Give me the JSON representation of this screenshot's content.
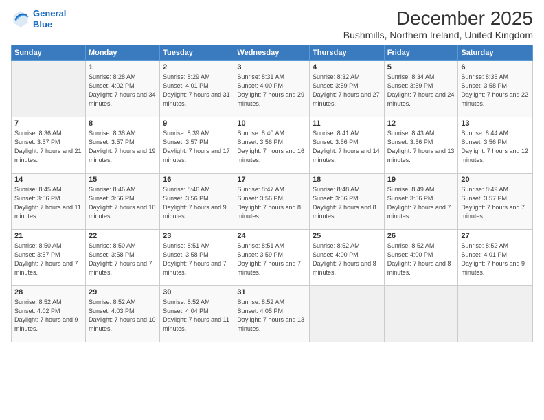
{
  "logo": {
    "line1": "General",
    "line2": "Blue"
  },
  "title": "December 2025",
  "subtitle": "Bushmills, Northern Ireland, United Kingdom",
  "header_days": [
    "Sunday",
    "Monday",
    "Tuesday",
    "Wednesday",
    "Thursday",
    "Friday",
    "Saturday"
  ],
  "weeks": [
    [
      {
        "day": "",
        "sunrise": "",
        "sunset": "",
        "daylight": ""
      },
      {
        "day": "1",
        "sunrise": "Sunrise: 8:28 AM",
        "sunset": "Sunset: 4:02 PM",
        "daylight": "Daylight: 7 hours and 34 minutes."
      },
      {
        "day": "2",
        "sunrise": "Sunrise: 8:29 AM",
        "sunset": "Sunset: 4:01 PM",
        "daylight": "Daylight: 7 hours and 31 minutes."
      },
      {
        "day": "3",
        "sunrise": "Sunrise: 8:31 AM",
        "sunset": "Sunset: 4:00 PM",
        "daylight": "Daylight: 7 hours and 29 minutes."
      },
      {
        "day": "4",
        "sunrise": "Sunrise: 8:32 AM",
        "sunset": "Sunset: 3:59 PM",
        "daylight": "Daylight: 7 hours and 27 minutes."
      },
      {
        "day": "5",
        "sunrise": "Sunrise: 8:34 AM",
        "sunset": "Sunset: 3:59 PM",
        "daylight": "Daylight: 7 hours and 24 minutes."
      },
      {
        "day": "6",
        "sunrise": "Sunrise: 8:35 AM",
        "sunset": "Sunset: 3:58 PM",
        "daylight": "Daylight: 7 hours and 22 minutes."
      }
    ],
    [
      {
        "day": "7",
        "sunrise": "Sunrise: 8:36 AM",
        "sunset": "Sunset: 3:57 PM",
        "daylight": "Daylight: 7 hours and 21 minutes."
      },
      {
        "day": "8",
        "sunrise": "Sunrise: 8:38 AM",
        "sunset": "Sunset: 3:57 PM",
        "daylight": "Daylight: 7 hours and 19 minutes."
      },
      {
        "day": "9",
        "sunrise": "Sunrise: 8:39 AM",
        "sunset": "Sunset: 3:57 PM",
        "daylight": "Daylight: 7 hours and 17 minutes."
      },
      {
        "day": "10",
        "sunrise": "Sunrise: 8:40 AM",
        "sunset": "Sunset: 3:56 PM",
        "daylight": "Daylight: 7 hours and 16 minutes."
      },
      {
        "day": "11",
        "sunrise": "Sunrise: 8:41 AM",
        "sunset": "Sunset: 3:56 PM",
        "daylight": "Daylight: 7 hours and 14 minutes."
      },
      {
        "day": "12",
        "sunrise": "Sunrise: 8:43 AM",
        "sunset": "Sunset: 3:56 PM",
        "daylight": "Daylight: 7 hours and 13 minutes."
      },
      {
        "day": "13",
        "sunrise": "Sunrise: 8:44 AM",
        "sunset": "Sunset: 3:56 PM",
        "daylight": "Daylight: 7 hours and 12 minutes."
      }
    ],
    [
      {
        "day": "14",
        "sunrise": "Sunrise: 8:45 AM",
        "sunset": "Sunset: 3:56 PM",
        "daylight": "Daylight: 7 hours and 11 minutes."
      },
      {
        "day": "15",
        "sunrise": "Sunrise: 8:46 AM",
        "sunset": "Sunset: 3:56 PM",
        "daylight": "Daylight: 7 hours and 10 minutes."
      },
      {
        "day": "16",
        "sunrise": "Sunrise: 8:46 AM",
        "sunset": "Sunset: 3:56 PM",
        "daylight": "Daylight: 7 hours and 9 minutes."
      },
      {
        "day": "17",
        "sunrise": "Sunrise: 8:47 AM",
        "sunset": "Sunset: 3:56 PM",
        "daylight": "Daylight: 7 hours and 8 minutes."
      },
      {
        "day": "18",
        "sunrise": "Sunrise: 8:48 AM",
        "sunset": "Sunset: 3:56 PM",
        "daylight": "Daylight: 7 hours and 8 minutes."
      },
      {
        "day": "19",
        "sunrise": "Sunrise: 8:49 AM",
        "sunset": "Sunset: 3:56 PM",
        "daylight": "Daylight: 7 hours and 7 minutes."
      },
      {
        "day": "20",
        "sunrise": "Sunrise: 8:49 AM",
        "sunset": "Sunset: 3:57 PM",
        "daylight": "Daylight: 7 hours and 7 minutes."
      }
    ],
    [
      {
        "day": "21",
        "sunrise": "Sunrise: 8:50 AM",
        "sunset": "Sunset: 3:57 PM",
        "daylight": "Daylight: 7 hours and 7 minutes."
      },
      {
        "day": "22",
        "sunrise": "Sunrise: 8:50 AM",
        "sunset": "Sunset: 3:58 PM",
        "daylight": "Daylight: 7 hours and 7 minutes."
      },
      {
        "day": "23",
        "sunrise": "Sunrise: 8:51 AM",
        "sunset": "Sunset: 3:58 PM",
        "daylight": "Daylight: 7 hours and 7 minutes."
      },
      {
        "day": "24",
        "sunrise": "Sunrise: 8:51 AM",
        "sunset": "Sunset: 3:59 PM",
        "daylight": "Daylight: 7 hours and 7 minutes."
      },
      {
        "day": "25",
        "sunrise": "Sunrise: 8:52 AM",
        "sunset": "Sunset: 4:00 PM",
        "daylight": "Daylight: 7 hours and 8 minutes."
      },
      {
        "day": "26",
        "sunrise": "Sunrise: 8:52 AM",
        "sunset": "Sunset: 4:00 PM",
        "daylight": "Daylight: 7 hours and 8 minutes."
      },
      {
        "day": "27",
        "sunrise": "Sunrise: 8:52 AM",
        "sunset": "Sunset: 4:01 PM",
        "daylight": "Daylight: 7 hours and 9 minutes."
      }
    ],
    [
      {
        "day": "28",
        "sunrise": "Sunrise: 8:52 AM",
        "sunset": "Sunset: 4:02 PM",
        "daylight": "Daylight: 7 hours and 9 minutes."
      },
      {
        "day": "29",
        "sunrise": "Sunrise: 8:52 AM",
        "sunset": "Sunset: 4:03 PM",
        "daylight": "Daylight: 7 hours and 10 minutes."
      },
      {
        "day": "30",
        "sunrise": "Sunrise: 8:52 AM",
        "sunset": "Sunset: 4:04 PM",
        "daylight": "Daylight: 7 hours and 11 minutes."
      },
      {
        "day": "31",
        "sunrise": "Sunrise: 8:52 AM",
        "sunset": "Sunset: 4:05 PM",
        "daylight": "Daylight: 7 hours and 13 minutes."
      },
      {
        "day": "",
        "sunrise": "",
        "sunset": "",
        "daylight": ""
      },
      {
        "day": "",
        "sunrise": "",
        "sunset": "",
        "daylight": ""
      },
      {
        "day": "",
        "sunrise": "",
        "sunset": "",
        "daylight": ""
      }
    ]
  ]
}
